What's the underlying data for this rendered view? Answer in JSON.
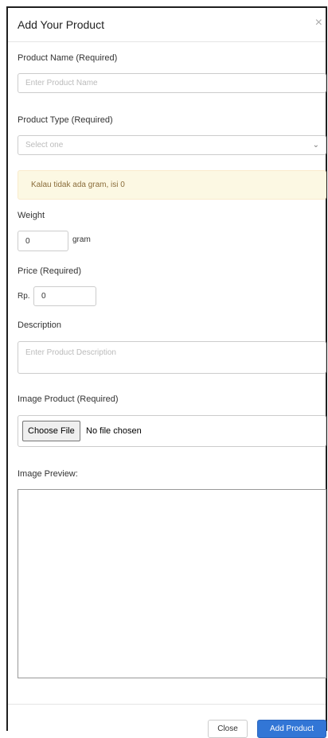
{
  "modal": {
    "title": "Add Your Product",
    "close_icon_glyph": "×"
  },
  "form": {
    "product_name": {
      "label": "Product Name (Required)",
      "placeholder": "Enter Product Name",
      "value": ""
    },
    "product_type": {
      "label": "Product Type (Required)",
      "selected": "Select one",
      "chevron_glyph": "⌄"
    },
    "alert": {
      "text": "Kalau tidak ada gram, isi 0"
    },
    "weight": {
      "label": "Weight",
      "value": "0",
      "unit": "gram"
    },
    "price": {
      "label": "Price (Required)",
      "prefix": "Rp.",
      "value": "0"
    },
    "description": {
      "label": "Description",
      "placeholder": "Enter Product Description",
      "value": ""
    },
    "image": {
      "label": "Image Product (Required)",
      "button": "Choose File",
      "status": "No file chosen"
    },
    "preview": {
      "label": "Image Preview:"
    }
  },
  "footer": {
    "close_label": "Close",
    "submit_label": "Add Product"
  },
  "colors": {
    "primary": "#3276d6",
    "alert_bg": "#fcf8e3",
    "alert_text": "#8a6d3b"
  }
}
